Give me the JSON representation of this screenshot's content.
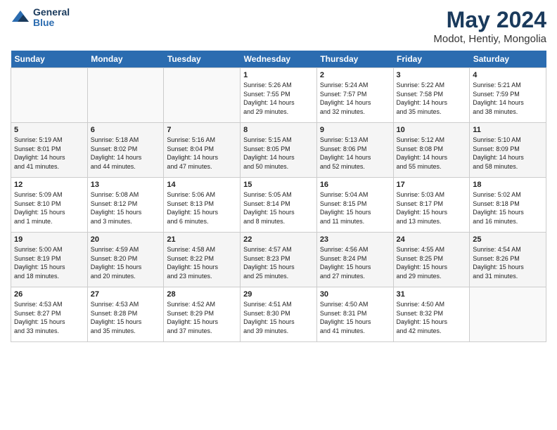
{
  "logo": {
    "line1": "General",
    "line2": "Blue"
  },
  "title": "May 2024",
  "subtitle": "Modot, Hentiy, Mongolia",
  "days_header": [
    "Sunday",
    "Monday",
    "Tuesday",
    "Wednesday",
    "Thursday",
    "Friday",
    "Saturday"
  ],
  "weeks": [
    [
      {
        "day": "",
        "info": ""
      },
      {
        "day": "",
        "info": ""
      },
      {
        "day": "",
        "info": ""
      },
      {
        "day": "1",
        "info": "Sunrise: 5:26 AM\nSunset: 7:55 PM\nDaylight: 14 hours\nand 29 minutes."
      },
      {
        "day": "2",
        "info": "Sunrise: 5:24 AM\nSunset: 7:57 PM\nDaylight: 14 hours\nand 32 minutes."
      },
      {
        "day": "3",
        "info": "Sunrise: 5:22 AM\nSunset: 7:58 PM\nDaylight: 14 hours\nand 35 minutes."
      },
      {
        "day": "4",
        "info": "Sunrise: 5:21 AM\nSunset: 7:59 PM\nDaylight: 14 hours\nand 38 minutes."
      }
    ],
    [
      {
        "day": "5",
        "info": "Sunrise: 5:19 AM\nSunset: 8:01 PM\nDaylight: 14 hours\nand 41 minutes."
      },
      {
        "day": "6",
        "info": "Sunrise: 5:18 AM\nSunset: 8:02 PM\nDaylight: 14 hours\nand 44 minutes."
      },
      {
        "day": "7",
        "info": "Sunrise: 5:16 AM\nSunset: 8:04 PM\nDaylight: 14 hours\nand 47 minutes."
      },
      {
        "day": "8",
        "info": "Sunrise: 5:15 AM\nSunset: 8:05 PM\nDaylight: 14 hours\nand 50 minutes."
      },
      {
        "day": "9",
        "info": "Sunrise: 5:13 AM\nSunset: 8:06 PM\nDaylight: 14 hours\nand 52 minutes."
      },
      {
        "day": "10",
        "info": "Sunrise: 5:12 AM\nSunset: 8:08 PM\nDaylight: 14 hours\nand 55 minutes."
      },
      {
        "day": "11",
        "info": "Sunrise: 5:10 AM\nSunset: 8:09 PM\nDaylight: 14 hours\nand 58 minutes."
      }
    ],
    [
      {
        "day": "12",
        "info": "Sunrise: 5:09 AM\nSunset: 8:10 PM\nDaylight: 15 hours\nand 1 minute."
      },
      {
        "day": "13",
        "info": "Sunrise: 5:08 AM\nSunset: 8:12 PM\nDaylight: 15 hours\nand 3 minutes."
      },
      {
        "day": "14",
        "info": "Sunrise: 5:06 AM\nSunset: 8:13 PM\nDaylight: 15 hours\nand 6 minutes."
      },
      {
        "day": "15",
        "info": "Sunrise: 5:05 AM\nSunset: 8:14 PM\nDaylight: 15 hours\nand 8 minutes."
      },
      {
        "day": "16",
        "info": "Sunrise: 5:04 AM\nSunset: 8:15 PM\nDaylight: 15 hours\nand 11 minutes."
      },
      {
        "day": "17",
        "info": "Sunrise: 5:03 AM\nSunset: 8:17 PM\nDaylight: 15 hours\nand 13 minutes."
      },
      {
        "day": "18",
        "info": "Sunrise: 5:02 AM\nSunset: 8:18 PM\nDaylight: 15 hours\nand 16 minutes."
      }
    ],
    [
      {
        "day": "19",
        "info": "Sunrise: 5:00 AM\nSunset: 8:19 PM\nDaylight: 15 hours\nand 18 minutes."
      },
      {
        "day": "20",
        "info": "Sunrise: 4:59 AM\nSunset: 8:20 PM\nDaylight: 15 hours\nand 20 minutes."
      },
      {
        "day": "21",
        "info": "Sunrise: 4:58 AM\nSunset: 8:22 PM\nDaylight: 15 hours\nand 23 minutes."
      },
      {
        "day": "22",
        "info": "Sunrise: 4:57 AM\nSunset: 8:23 PM\nDaylight: 15 hours\nand 25 minutes."
      },
      {
        "day": "23",
        "info": "Sunrise: 4:56 AM\nSunset: 8:24 PM\nDaylight: 15 hours\nand 27 minutes."
      },
      {
        "day": "24",
        "info": "Sunrise: 4:55 AM\nSunset: 8:25 PM\nDaylight: 15 hours\nand 29 minutes."
      },
      {
        "day": "25",
        "info": "Sunrise: 4:54 AM\nSunset: 8:26 PM\nDaylight: 15 hours\nand 31 minutes."
      }
    ],
    [
      {
        "day": "26",
        "info": "Sunrise: 4:53 AM\nSunset: 8:27 PM\nDaylight: 15 hours\nand 33 minutes."
      },
      {
        "day": "27",
        "info": "Sunrise: 4:53 AM\nSunset: 8:28 PM\nDaylight: 15 hours\nand 35 minutes."
      },
      {
        "day": "28",
        "info": "Sunrise: 4:52 AM\nSunset: 8:29 PM\nDaylight: 15 hours\nand 37 minutes."
      },
      {
        "day": "29",
        "info": "Sunrise: 4:51 AM\nSunset: 8:30 PM\nDaylight: 15 hours\nand 39 minutes."
      },
      {
        "day": "30",
        "info": "Sunrise: 4:50 AM\nSunset: 8:31 PM\nDaylight: 15 hours\nand 41 minutes."
      },
      {
        "day": "31",
        "info": "Sunrise: 4:50 AM\nSunset: 8:32 PM\nDaylight: 15 hours\nand 42 minutes."
      },
      {
        "day": "",
        "info": ""
      }
    ]
  ]
}
